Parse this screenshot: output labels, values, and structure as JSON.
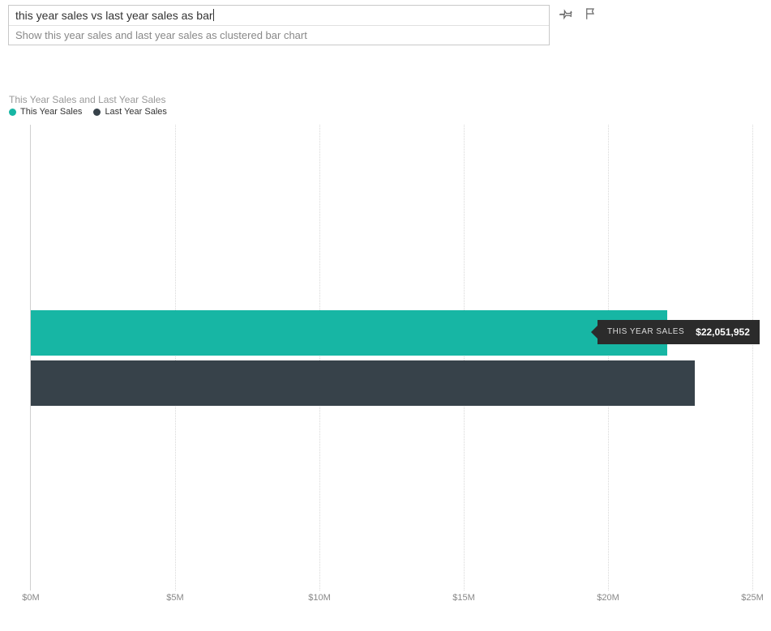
{
  "query": {
    "text": "this year sales vs last year sales as bar",
    "hint": "Show this year sales and last year sales as clustered bar chart"
  },
  "chart": {
    "title": "This Year Sales and Last Year Sales",
    "legend": [
      {
        "label": "This Year Sales",
        "color": "#17b6a4"
      },
      {
        "label": "Last Year Sales",
        "color": "#37424a"
      }
    ]
  },
  "tooltip": {
    "label": "THIS YEAR SALES",
    "value": "$22,051,952"
  },
  "chart_data": {
    "type": "bar",
    "orientation": "horizontal",
    "categories": [
      ""
    ],
    "series": [
      {
        "name": "This Year Sales",
        "values": [
          22051952
        ],
        "color": "#17b6a4"
      },
      {
        "name": "Last Year Sales",
        "values": [
          23000000
        ],
        "color": "#37424a"
      }
    ],
    "title": "This Year Sales and Last Year Sales",
    "xlabel": "",
    "ylabel": "",
    "xlim": [
      0,
      25000000
    ],
    "x_ticks": [
      0,
      5000000,
      10000000,
      15000000,
      20000000,
      25000000
    ],
    "x_tick_labels": [
      "$0M",
      "$5M",
      "$10M",
      "$15M",
      "$20M",
      "$25M"
    ]
  }
}
